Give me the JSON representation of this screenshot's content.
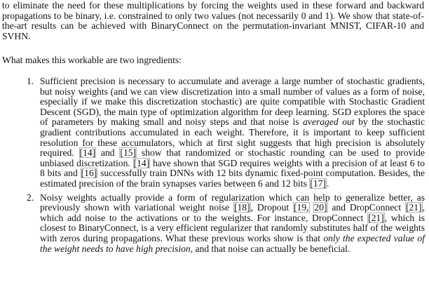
{
  "intro": {
    "text": "to eliminate the need for these multiplications by forcing the weights used in these forward and backward propagations to be binary, i.e. constrained to only two values (not necessarily 0 and 1). We show that state-of-the-art results can be achieved with BinaryConnect on the permutation-invariant MNIST, CIFAR-10 and SVHN."
  },
  "lead": {
    "text": "What makes this workable are two ingredients:"
  },
  "items": [
    {
      "number": "1.",
      "t1": "Sufficient precision is necessary to accumulate and average a large number of stochastic gradients, but noisy weights (and we can view discretization into a small number of values as a form of noise, especially if we make this discretization stochastic) are quite compatible with Stochastic Gradient Descent (SGD), the main type of optimization algorithm for deep learning.  SGD explores the space of parameters by making small and noisy steps and that noise is ",
      "em1": "averaged out",
      "t2": " by the stochastic gradient contributions accumulated in each weight.  Therefore, it is important to keep sufficient resolution for these accumulators, which at first sight suggests that high precision is absolutely required. ",
      "c14a": "[14]",
      "t3": " and ",
      "c15": "[15]",
      "t4": " show that randomized or stochastic rounding can be used to provide unbiased discretization. ",
      "c14b": "[14]",
      "t5": " have shown that SGD requires weights with a precision of at least 6 to 8 bits and ",
      "c16": "[16]",
      "t6": " successfully train DNNs with 12 bits dynamic fixed-point computation.  Besides, the estimated precision of the brain synapses varies between 6 and 12 bits ",
      "c17": "[17]",
      "t7": "."
    },
    {
      "number": "2.",
      "t1": "Noisy weights actually provide a form of regularization which can help to generalize better, as previously shown with variational weight noise ",
      "c18": "[18]",
      "t2": ", Dropout ",
      "c19": "[19,",
      "t3": " ",
      "c20": "20]",
      "t4": " and DropConnect ",
      "c21a": "[21]",
      "t5": ", which add noise to the activations or to the weights. For instance, DropConnect ",
      "c21b": "[21]",
      "t6": ", which is closest to BinaryConnect, is a very efficient regularizer that randomly substitutes half of the weights with zeros during propagations. What these previous works show is that ",
      "em1": "only the expected value of the weight needs to have high precision",
      "t7": ", and that noise can actually be beneficial."
    }
  ]
}
